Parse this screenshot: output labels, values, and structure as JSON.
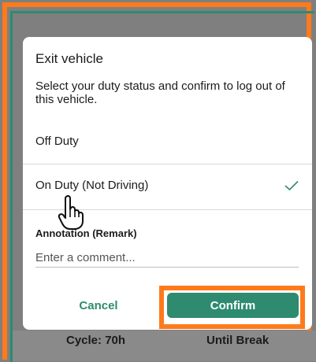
{
  "dialog": {
    "title": "Exit vehicle",
    "description": "Select your duty status and confirm to log out of this vehicle.",
    "options": [
      {
        "label": "Off Duty",
        "selected": false
      },
      {
        "label": "On Duty (Not Driving)",
        "selected": true
      }
    ],
    "annotation": {
      "label": "Annotation (Remark)",
      "placeholder": "Enter a comment...",
      "value": ""
    },
    "cancel_label": "Cancel",
    "confirm_label": "Confirm"
  },
  "background": {
    "cycle_label": "Cycle: 70h",
    "break_label": "Until Break"
  },
  "colors": {
    "accent": "#2e8b70",
    "highlight": "#ff7a1a",
    "overlay": "#7f7f7f"
  },
  "icons": {
    "selected": "check-icon",
    "cursor": "hand-pointer-icon"
  }
}
